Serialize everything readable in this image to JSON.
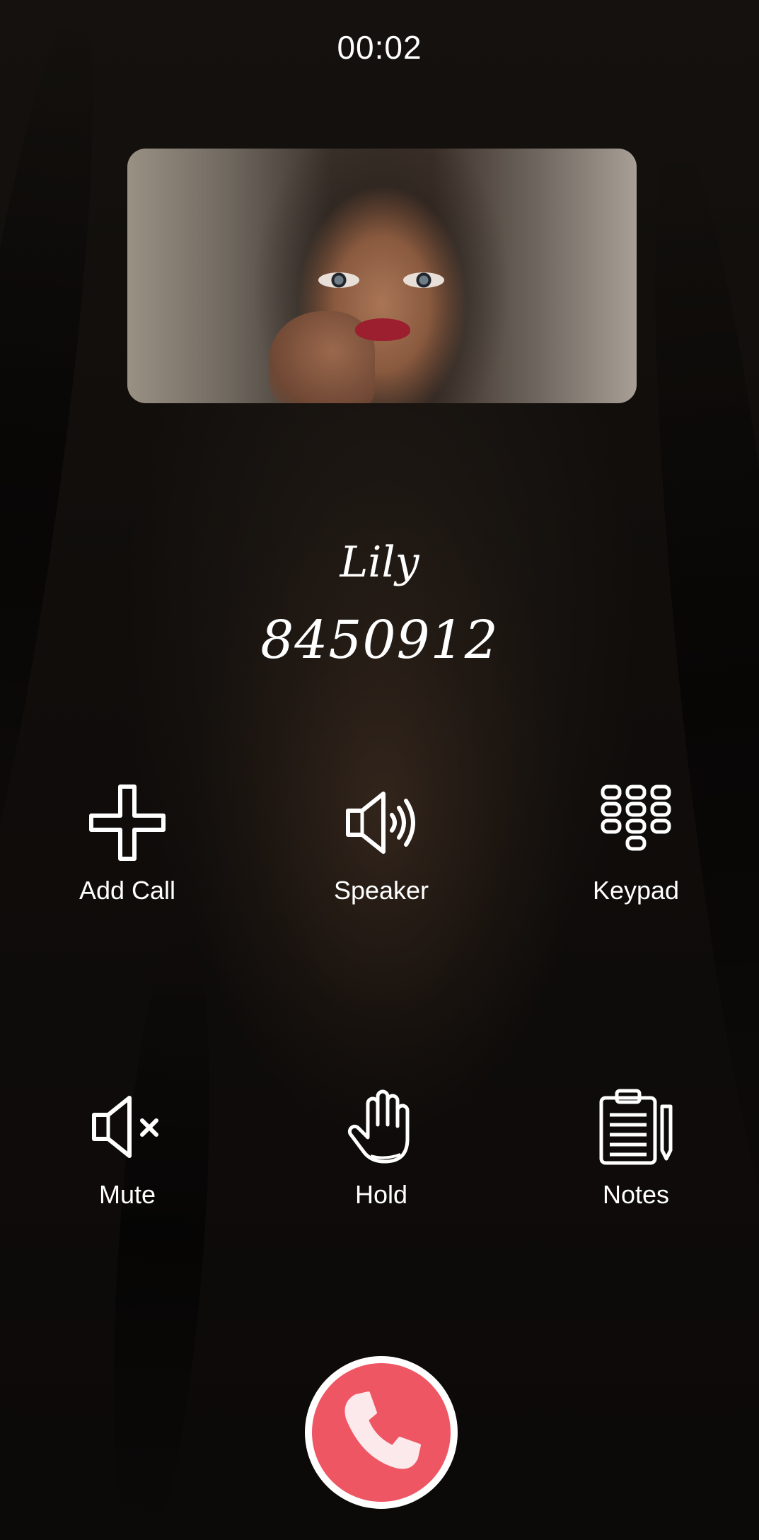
{
  "call": {
    "timer": "00:02",
    "contact_name": "Lily",
    "phone_number": "8450912"
  },
  "actions": {
    "add_call": {
      "label": "Add Call",
      "icon": "plus-icon"
    },
    "speaker": {
      "label": "Speaker",
      "icon": "speaker-icon"
    },
    "keypad": {
      "label": "Keypad",
      "icon": "keypad-icon"
    },
    "mute": {
      "label": "Mute",
      "icon": "mute-icon"
    },
    "hold": {
      "label": "Hold",
      "icon": "hand-icon"
    },
    "notes": {
      "label": "Notes",
      "icon": "clipboard-icon"
    }
  },
  "end_call": {
    "icon": "phone-hangup-icon"
  },
  "colors": {
    "end_call": "#ef5664",
    "icon_stroke": "#ffffff",
    "background": "#0e0c0a"
  }
}
